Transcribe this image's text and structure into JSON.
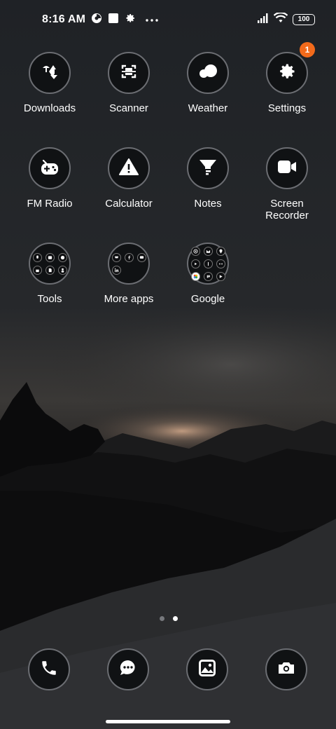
{
  "status_bar": {
    "time": "8:16 AM",
    "battery": "100",
    "left_icons": [
      "data-saver-icon",
      "square-notification-icon",
      "gear-icon",
      "more-dots-icon"
    ],
    "right_icons": [
      "cell-signal-icon",
      "wifi-icon",
      "battery-icon"
    ]
  },
  "apps": [
    {
      "label": "Downloads",
      "icon": "download-icon"
    },
    {
      "label": "Scanner",
      "icon": "scanner-icon"
    },
    {
      "label": "Weather",
      "icon": "cloud-icon"
    },
    {
      "label": "Settings",
      "icon": "gear-icon",
      "badge": "1"
    },
    {
      "label": "FM Radio",
      "icon": "radio-icon"
    },
    {
      "label": "Calculator",
      "icon": "warning-triangle-icon"
    },
    {
      "label": "Notes",
      "icon": "funnel-icon"
    },
    {
      "label": "Screen\nRecorder",
      "icon": "video-camera-icon"
    }
  ],
  "folders": [
    {
      "label": "Tools"
    },
    {
      "label": "More apps"
    },
    {
      "label": "Google"
    }
  ],
  "dock": [
    {
      "name": "phone",
      "icon": "phone-icon"
    },
    {
      "name": "messages",
      "icon": "chat-bubble-icon"
    },
    {
      "name": "gallery",
      "icon": "gallery-icon"
    },
    {
      "name": "camera",
      "icon": "camera-icon"
    }
  ],
  "colors": {
    "badge": "#f26a1b",
    "icon_ring": "#6b6d72",
    "icon_bg": "#101214"
  },
  "page_indicator": {
    "pages": 2,
    "current": 2
  }
}
